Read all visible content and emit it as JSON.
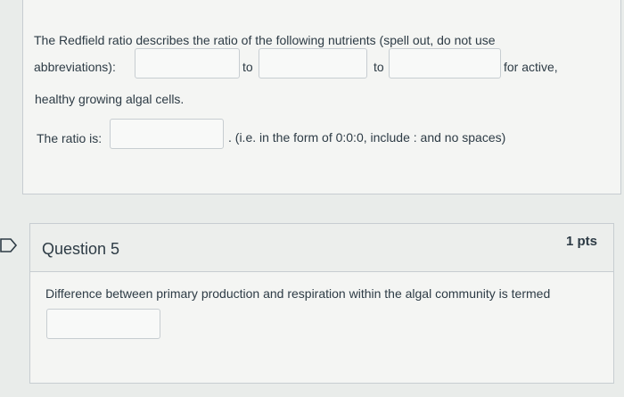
{
  "question4": {
    "intro_line1": "The Redfield ratio describes the ratio of the following nutrients (spell out, do not use",
    "abbreviations_label": "abbreviations):",
    "to_label_1": "to",
    "to_label_2": "to",
    "for_active": "for active,",
    "line3": "healthy growing algal cells.",
    "ratio_label": "The ratio is:",
    "ratio_hint": ". (i.e. in the form of 0:0:0, include : and no spaces)",
    "inputs": {
      "nutrient1": "",
      "nutrient2": "",
      "nutrient3": "",
      "ratio": ""
    }
  },
  "question5": {
    "title": "Question 5",
    "points": "1 pts",
    "prompt": "Difference between primary production and respiration within the algal community is termed",
    "answer": ""
  }
}
